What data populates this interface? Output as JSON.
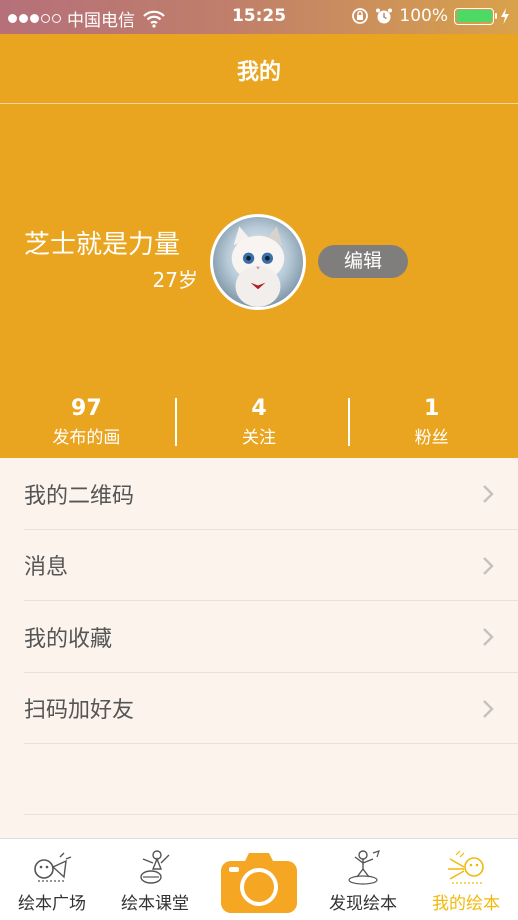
{
  "status_bar": {
    "carrier": "中国电信",
    "time": "15:25",
    "battery": "100%",
    "signal_dots_filled": 3,
    "signal_dots_total": 5
  },
  "header": {
    "title": "我的"
  },
  "profile": {
    "name": "芝士就是力量",
    "age": "27岁",
    "edit_label": "编辑"
  },
  "stats": [
    {
      "value": "97",
      "label": "发布的画"
    },
    {
      "value": "4",
      "label": "关注"
    },
    {
      "value": "1",
      "label": "粉丝"
    }
  ],
  "menu": [
    {
      "label": "我的二维码"
    },
    {
      "label": "消息"
    },
    {
      "label": "我的收藏"
    },
    {
      "label": "扫码加好友"
    }
  ],
  "tabs": [
    {
      "label": "绘本广场",
      "icon": "plaza-icon"
    },
    {
      "label": "绘本课堂",
      "icon": "classroom-icon"
    },
    {
      "label": "",
      "icon": "camera-icon"
    },
    {
      "label": "发现绘本",
      "icon": "discover-icon"
    },
    {
      "label": "我的绘本",
      "icon": "my-books-icon",
      "active": true
    }
  ],
  "colors": {
    "accent": "#eaa520",
    "active_tab": "#f1b90c",
    "background": "#fbf3ec",
    "battery_green": "#4cd964"
  }
}
